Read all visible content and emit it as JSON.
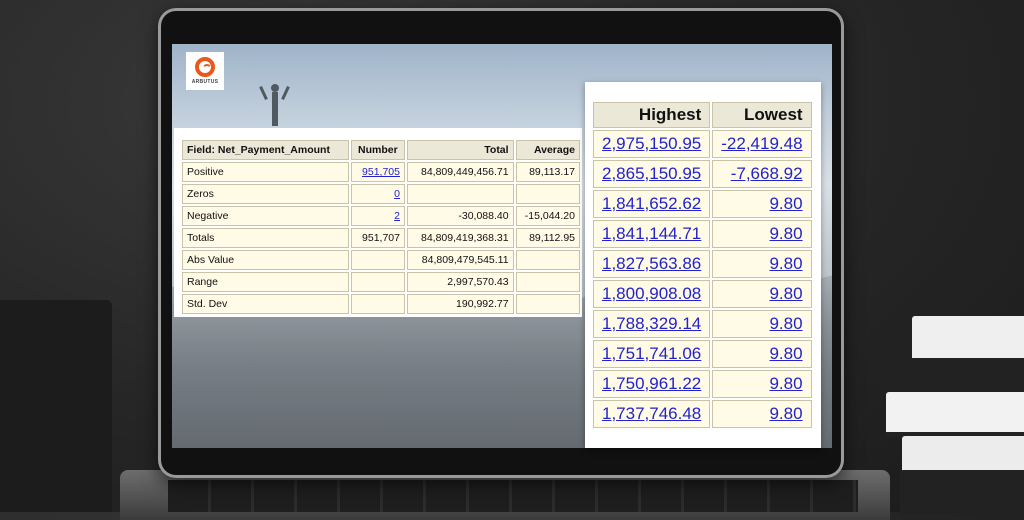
{
  "logo": {
    "text": "ARBUTUS"
  },
  "stats": {
    "headers": [
      "Field: Net_Payment_Amount",
      "Number",
      "Total",
      "Average"
    ],
    "rows": [
      {
        "label": "Positive",
        "number": "951,705",
        "total": "84,809,449,456.71",
        "average": "89,113.17"
      },
      {
        "label": "Zeros",
        "number": "0",
        "total": "",
        "average": ""
      },
      {
        "label": "Negative",
        "number": "2",
        "total": "-30,088.40",
        "average": "-15,044.20"
      },
      {
        "label": "Totals",
        "number": "951,707",
        "total": "84,809,419,368.31",
        "average": "89,112.95"
      },
      {
        "label": "Abs Value",
        "number": "",
        "total": "84,809,479,545.11",
        "average": ""
      },
      {
        "label": "Range",
        "number": "",
        "total": "2,997,570.43",
        "average": ""
      },
      {
        "label": "Std. Dev",
        "number": "",
        "total": "190,992.77",
        "average": ""
      }
    ]
  },
  "highlow": {
    "headers": [
      "Highest",
      "Lowest"
    ],
    "rows": [
      {
        "highest": "2,975,150.95",
        "lowest": "-22,419.48"
      },
      {
        "highest": "2,865,150.95",
        "lowest": "-7,668.92"
      },
      {
        "highest": "1,841,652.62",
        "lowest": "9.80"
      },
      {
        "highest": "1,841,144.71",
        "lowest": "9.80"
      },
      {
        "highest": "1,827,563.86",
        "lowest": "9.80"
      },
      {
        "highest": "1,800,908.08",
        "lowest": "9.80"
      },
      {
        "highest": "1,788,329.14",
        "lowest": "9.80"
      },
      {
        "highest": "1,751,741.06",
        "lowest": "9.80"
      },
      {
        "highest": "1,750,961.22",
        "lowest": "9.80"
      },
      {
        "highest": "1,737,746.48",
        "lowest": "9.80"
      }
    ]
  },
  "colors": {
    "link": "#2323cc",
    "cell": "#fffbe6",
    "header": "#ebe8d8",
    "logo": "#e85a1b"
  }
}
